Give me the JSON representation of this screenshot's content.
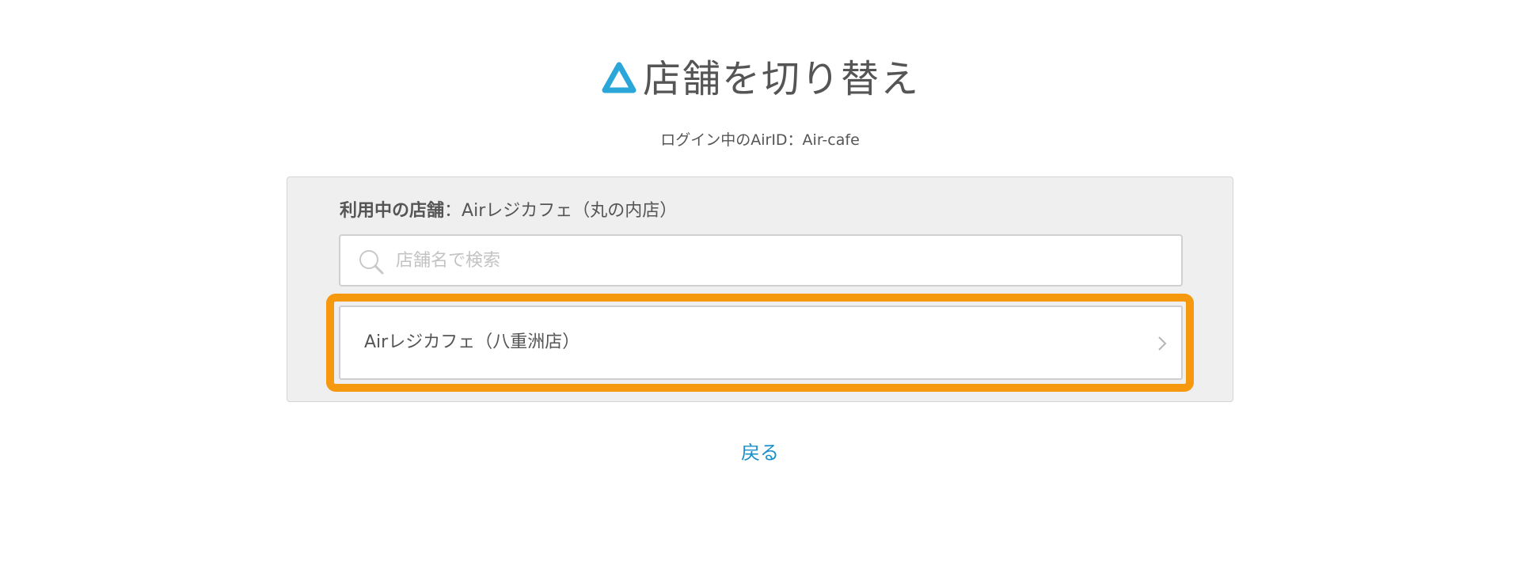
{
  "header": {
    "logo_icon": "air-triangle-logo-icon",
    "title": "店舗を切り替え"
  },
  "login": {
    "text": "ログイン中のAirID：Air-cafe"
  },
  "current_store": {
    "label": "利用中の店舗",
    "separator": "：",
    "value": "Airレジカフェ（丸の内店）"
  },
  "search": {
    "icon": "search-icon",
    "placeholder": "店舗名で検索",
    "value": ""
  },
  "stores": [
    {
      "name": "Airレジカフェ（八重洲店）",
      "icon": "chevron-right-icon"
    }
  ],
  "back": {
    "label": "戻る"
  },
  "colors": {
    "brand": "#2aa6d8",
    "highlight": "#f7990f",
    "link": "#1a8fc9",
    "panel_bg": "#efefef",
    "text": "#555555"
  }
}
